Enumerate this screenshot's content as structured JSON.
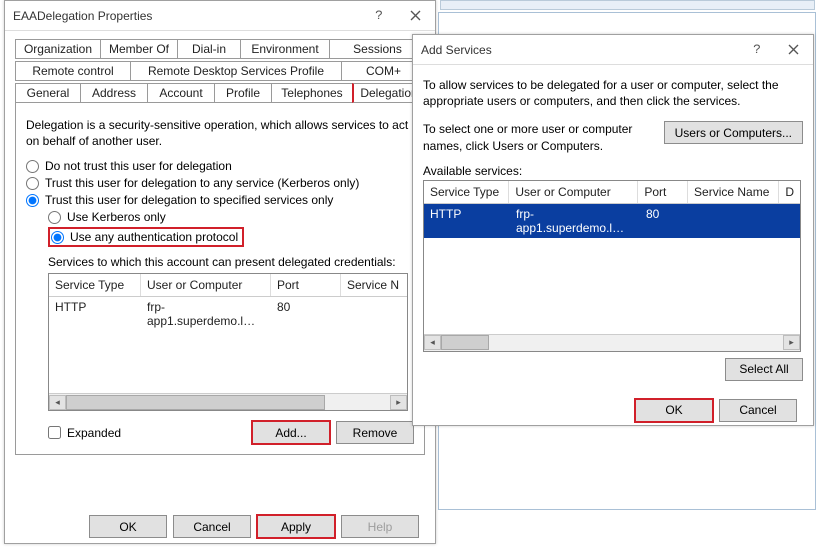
{
  "props_dialog": {
    "title": "EAADelegation Properties",
    "tabs_row1": [
      "Organization",
      "Member Of",
      "Dial-in",
      "Environment",
      "Sessions"
    ],
    "tabs_row2": [
      "Remote control",
      "Remote Desktop Services Profile",
      "COM+"
    ],
    "tabs_row3": [
      "General",
      "Address",
      "Account",
      "Profile",
      "Telephones",
      "Delegation"
    ],
    "delegation": {
      "explain": "Delegation is a security-sensitive operation, which allows services to act on behalf of another user.",
      "opt1": "Do not trust this user for delegation",
      "opt2": "Trust this user for delegation to any service (Kerberos only)",
      "opt3": "Trust this user for delegation to specified services only",
      "sub1": "Use Kerberos only",
      "sub2": "Use any authentication protocol",
      "tbl_label": "Services to which this account can present delegated credentials:",
      "columns": {
        "c1": "Service Type",
        "c2": "User or Computer",
        "c3": "Port",
        "c4": "Service N"
      },
      "row": {
        "svc": "HTTP",
        "uc": "frp-app1.superdemo.l…",
        "port": "80"
      },
      "expanded_label": "Expanded",
      "add_label": "Add...",
      "remove_label": "Remove"
    },
    "footer": {
      "ok": "OK",
      "cancel": "Cancel",
      "apply": "Apply",
      "help": "Help"
    }
  },
  "add_dialog": {
    "title": "Add Services",
    "intro": "To allow services to be delegated for a user or computer, select the appropriate users or computers, and then click the services.",
    "select_text": "To select one or more user or computer names, click Users or Computers.",
    "users_btn": "Users or Computers...",
    "available_label": "Available services:",
    "columns": {
      "c1": "Service Type",
      "c2": "User or Computer",
      "c3": "Port",
      "c4": "Service Name",
      "c5": "D"
    },
    "row": {
      "svc": "HTTP",
      "uc": "frp-app1.superdemo.l…",
      "port": "80"
    },
    "select_all": "Select All",
    "ok": "OK",
    "cancel": "Cancel"
  }
}
